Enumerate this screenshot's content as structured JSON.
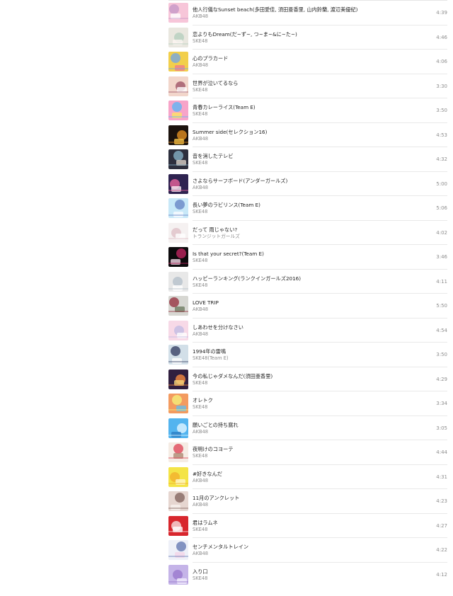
{
  "tracks": [
    {
      "title": "他人行儀なSunset beach(多田愛佳, 須田亜香里, 山内鈴蘭, 渡辺美優紀)",
      "artist": "AKB48",
      "duration": "4:39",
      "art": {
        "c1": "#f7c6d9",
        "c2": "#c99ac8",
        "c3": "#ffffff"
      }
    },
    {
      "title": "恋よりもDream(だ~ず~, つ~ま~&に~た~)",
      "artist": "SKE48",
      "duration": "4:46",
      "art": {
        "c1": "#e9e7df",
        "c2": "#b9d0c1",
        "c3": "#fef6f3"
      }
    },
    {
      "title": "心のプラカード",
      "artist": "AKB48",
      "duration": "4:06",
      "art": {
        "c1": "#f2cf4b",
        "c2": "#7ea9d7",
        "c3": "#f1798b"
      }
    },
    {
      "title": "世界が泣いてるなら",
      "artist": "SKE48",
      "duration": "3:30",
      "art": {
        "c1": "#f2d6cb",
        "c2": "#a55d6f",
        "c3": "#ffffff"
      }
    },
    {
      "title": "青春カレーライス(Team E)",
      "artist": "SKE48",
      "duration": "3:50",
      "art": {
        "c1": "#f7a4c9",
        "c2": "#69b5f2",
        "c3": "#fde364"
      }
    },
    {
      "title": "Summer side(セレクション16)",
      "artist": "AKB48",
      "duration": "4:53",
      "art": {
        "c1": "#1b120d",
        "c2": "#d58720",
        "c3": "#f5c347"
      }
    },
    {
      "title": "音を消したテレビ",
      "artist": "SKE48",
      "duration": "4:32",
      "art": {
        "c1": "#2d2f3d",
        "c2": "#7fa7bc",
        "c3": "#d8cfc6"
      }
    },
    {
      "title": "さよならサーフボード(アンダーガールズ)",
      "artist": "AKB48",
      "duration": "5:00",
      "art": {
        "c1": "#2e2350",
        "c2": "#dc5f96",
        "c3": "#f8ebf2"
      }
    },
    {
      "title": "長い夢のラビリンス(Team E)",
      "artist": "SKE48",
      "duration": "5:06",
      "art": {
        "c1": "#c8e8f8",
        "c2": "#6e8cc9",
        "c3": "#fbfbff"
      }
    },
    {
      "title": "だって 雨じゃない?",
      "artist": "トランジットガールズ",
      "duration": "4:02",
      "art": {
        "c1": "#f5f1f1",
        "c2": "#e0c4ca",
        "c3": "#ffffff"
      }
    },
    {
      "title": "Is that your secret?(Team E)",
      "artist": "SKE48",
      "duration": "3:46",
      "art": {
        "c1": "#0d0b0d",
        "c2": "#b3235a",
        "c3": "#f3d8e7"
      }
    },
    {
      "title": "ハッピーランキング(ランクインガールズ2016)",
      "artist": "SKE48",
      "duration": "4:11",
      "art": {
        "c1": "#e8e8e8",
        "c2": "#b8c3cc",
        "c3": "#ffffff"
      }
    },
    {
      "title": "LOVE TRIP",
      "artist": "AKB48",
      "duration": "5:50",
      "art": {
        "c1": "#d7d7d2",
        "c2": "#9b3e4b",
        "c3": "#6f7d63"
      }
    },
    {
      "title": "しあわせを分けなさい",
      "artist": "AKB48",
      "duration": "4:54",
      "art": {
        "c1": "#f7d9e7",
        "c2": "#c5bde3",
        "c3": "#ffffff"
      }
    },
    {
      "title": "1994年の雷鳴",
      "artist": "SKE48(Team E)",
      "duration": "3:50",
      "art": {
        "c1": "#d2dfe8",
        "c2": "#424b6d",
        "c3": "#fefefe"
      }
    },
    {
      "title": "今の私じゃダメなんだ(須田亜香里)",
      "artist": "SKE48",
      "duration": "4:29",
      "art": {
        "c1": "#311f3f",
        "c2": "#eb8440",
        "c3": "#f5d57a"
      }
    },
    {
      "title": "オレトク",
      "artist": "SKE48",
      "duration": "3:34",
      "art": {
        "c1": "#f39b60",
        "c2": "#f5ea78",
        "c3": "#66bde9"
      }
    },
    {
      "title": "願いごとの持ち腐れ",
      "artist": "AKB48",
      "duration": "3:05",
      "art": {
        "c1": "#53b4ef",
        "c2": "#d8f1ff",
        "c3": "#2d7ec4"
      }
    },
    {
      "title": "夜明けのコヨーテ",
      "artist": "SKE48",
      "duration": "4:44",
      "art": {
        "c1": "#f5ece4",
        "c2": "#e15363",
        "c3": "#ae8a72"
      }
    },
    {
      "title": "#好きなんだ",
      "artist": "AKB48",
      "duration": "4:31",
      "art": {
        "c1": "#f4e447",
        "c2": "#f2b42f",
        "c3": "#fff8cb"
      }
    },
    {
      "title": "11月のアンクレット",
      "artist": "AKB48",
      "duration": "4:23",
      "art": {
        "c1": "#e6d6d0",
        "c2": "#8a6d67",
        "c3": "#f9f2ef"
      }
    },
    {
      "title": "君はラムネ",
      "artist": "SKE48",
      "duration": "4:27",
      "art": {
        "c1": "#d8262d",
        "c2": "#f4d3d4",
        "c3": "#ffffff"
      }
    },
    {
      "title": "センチメンタルトレイン",
      "artist": "AKB48",
      "duration": "4:22",
      "art": {
        "c1": "#eef0f8",
        "c2": "#6f81b7",
        "c3": "#f4d5e7"
      }
    },
    {
      "title": "入り口",
      "artist": "SKE48",
      "duration": "4:12",
      "art": {
        "c1": "#c5b4e8",
        "c2": "#9c7dcf",
        "c3": "#f3effd"
      }
    }
  ]
}
